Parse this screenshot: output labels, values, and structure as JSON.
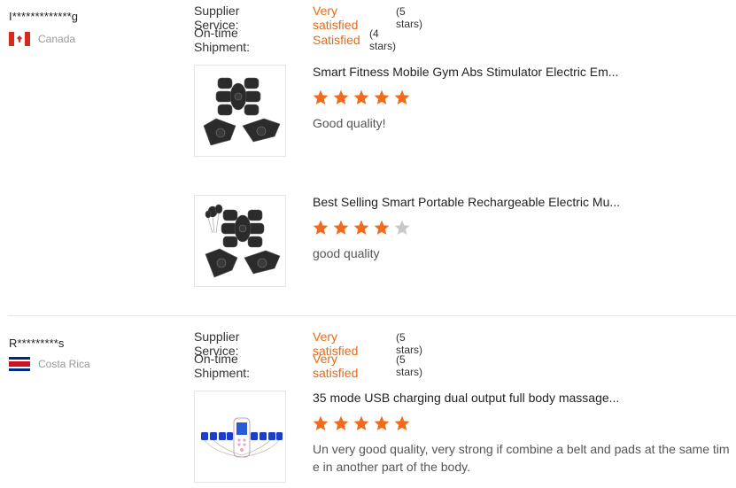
{
  "reviews": [
    {
      "buyer": "I*************g",
      "country": "Canada",
      "supplier_service": {
        "label": "Supplier Service:",
        "value": "Very satisfied",
        "stars_text": "(5 stars)"
      },
      "shipment": {
        "label": "On-time Shipment:",
        "value": "Satisfied",
        "stars_text": "(4 stars)"
      },
      "products": [
        {
          "title": "Smart Fitness Mobile Gym Abs Stimulator Electric Em...",
          "rating": 5,
          "comment": "Good quality!",
          "image": "abs-stimulator-image"
        },
        {
          "title": "Best Selling Smart Portable Rechargeable Electric Mu...",
          "rating": 4,
          "comment": "good quality",
          "image": "abs-stimulator-balloons-image"
        }
      ]
    },
    {
      "buyer": "R*********s",
      "country": "Costa Rica",
      "supplier_service": {
        "label": "Supplier Service:",
        "value": "Very satisfied",
        "stars_text": "(5 stars)"
      },
      "shipment": {
        "label": "On-time Shipment:",
        "value": "Very satisfied",
        "stars_text": "(5 stars)"
      },
      "products": [
        {
          "title": "35 mode USB charging dual output full body massage...",
          "rating": 5,
          "comment": "Un very good quality, very strong if combine a belt and pads at the same time in another part of the body.",
          "image": "tens-massager-image"
        }
      ]
    }
  ],
  "colors": {
    "accent": "#e46a19",
    "star_on": "#f26b1d",
    "star_off": "#c8c8c8"
  }
}
